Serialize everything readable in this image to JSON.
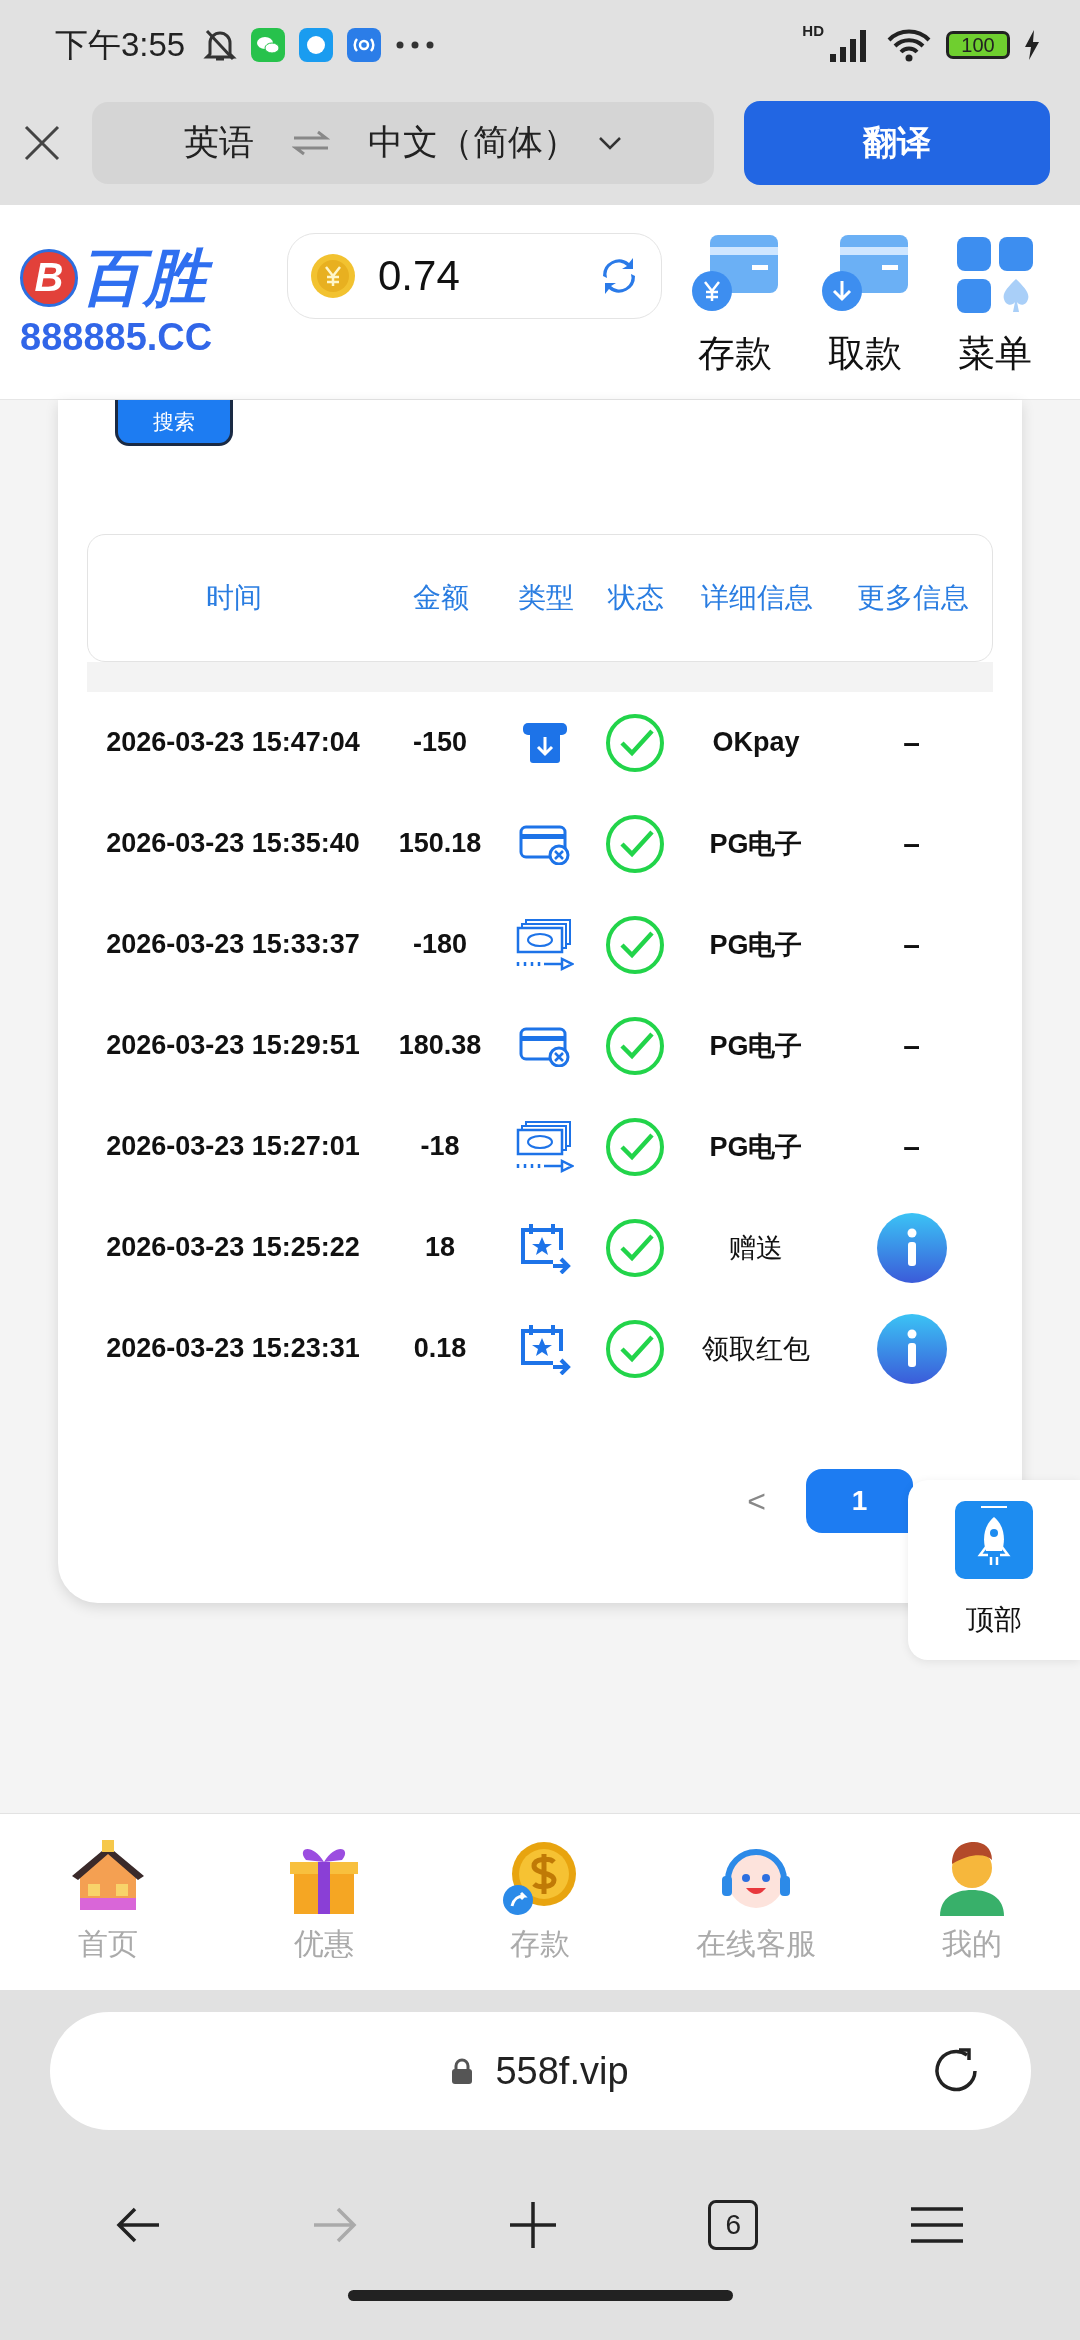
{
  "status_bar": {
    "time": "下午3:55",
    "network": "HD",
    "battery": "100"
  },
  "translate_bar": {
    "source_language": "英语",
    "target_language": "中文（简体）",
    "translate_button": "翻译"
  },
  "site_header": {
    "logo_badge": "B",
    "logo_title": "百胜",
    "logo_domain": "888885.CC",
    "balance": "0.74",
    "actions": [
      {
        "label": "存款",
        "kind": "deposit"
      },
      {
        "label": "取款",
        "kind": "withdraw"
      },
      {
        "label": "菜单",
        "kind": "menu"
      }
    ]
  },
  "search_button": "搜索",
  "table": {
    "columns": [
      "时间",
      "金额",
      "类型",
      "状态",
      "详细信息",
      "更多信息"
    ],
    "rows": [
      {
        "time": "2026-03-23 15:47:04",
        "amount": "-150",
        "type": {
          "kind": "atm"
        },
        "status": {
          "kind": "success"
        },
        "detail": "OKpay",
        "more": {
          "kind": "dash",
          "text": "–"
        }
      },
      {
        "time": "2026-03-23 15:35:40",
        "amount": "150.18",
        "type": {
          "kind": "card"
        },
        "status": {
          "kind": "success"
        },
        "detail": "PG电子",
        "more": {
          "kind": "dash",
          "text": "–"
        }
      },
      {
        "time": "2026-03-23 15:33:37",
        "amount": "-180",
        "type": {
          "kind": "cash"
        },
        "status": {
          "kind": "success"
        },
        "detail": "PG电子",
        "more": {
          "kind": "dash",
          "text": "–"
        }
      },
      {
        "time": "2026-03-23 15:29:51",
        "amount": "180.38",
        "type": {
          "kind": "card"
        },
        "status": {
          "kind": "success"
        },
        "detail": "PG电子",
        "more": {
          "kind": "dash",
          "text": "–"
        }
      },
      {
        "time": "2026-03-23 15:27:01",
        "amount": "-18",
        "type": {
          "kind": "cash"
        },
        "status": {
          "kind": "success"
        },
        "detail": "PG电子",
        "more": {
          "kind": "dash",
          "text": "–"
        }
      },
      {
        "time": "2026-03-23 15:25:22",
        "amount": "18",
        "type": {
          "kind": "event"
        },
        "status": {
          "kind": "success"
        },
        "detail": "赠送",
        "more": {
          "kind": "info"
        }
      },
      {
        "time": "2026-03-23 15:23:31",
        "amount": "0.18",
        "type": {
          "kind": "event"
        },
        "status": {
          "kind": "success"
        },
        "detail": "领取红包",
        "more": {
          "kind": "info"
        }
      }
    ]
  },
  "pagination": {
    "prev": "<",
    "pages": [
      {
        "label": "1",
        "selected": true
      }
    ]
  },
  "back_to_top": "顶部",
  "bottom_nav": [
    {
      "label": "首页",
      "kind": "home",
      "selected": false
    },
    {
      "label": "优惠",
      "kind": "promo",
      "selected": false
    },
    {
      "label": "存款",
      "kind": "deposit",
      "selected": false
    },
    {
      "label": "在线客服",
      "kind": "support",
      "selected": false
    },
    {
      "label": "我的",
      "kind": "profile",
      "selected": false
    }
  ],
  "browser": {
    "url": "558f.vip",
    "toolbar": [
      {
        "kind": "back",
        "disabled": false
      },
      {
        "kind": "forward",
        "disabled": true
      },
      {
        "kind": "new_tab",
        "disabled": false
      },
      {
        "kind": "tabs",
        "label": "6",
        "disabled": false
      },
      {
        "kind": "menu",
        "disabled": false
      }
    ]
  }
}
